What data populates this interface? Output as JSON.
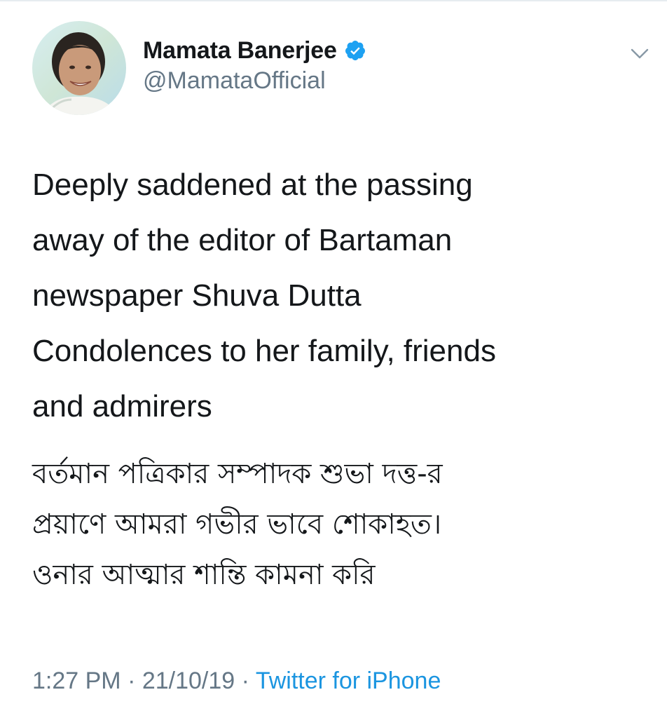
{
  "user": {
    "display_name": "Mamata Banerjee",
    "handle": "@MamataOfficial",
    "verified": true
  },
  "tweet": {
    "english_lines": [
      "Deeply saddened at the passing",
      "away of the editor of Bartaman",
      "newspaper Shuva Dutta",
      "Condolences to her family, friends",
      "and admirers"
    ],
    "bengali_lines": [
      "বর্তমান পত্রিকার সম্পাদক শুভা দত্ত-র",
      "প্রয়াণে আমরা গভীর ভাবে শোকাহত।",
      "ওনার আত্মার শান্তি কামনা করি"
    ]
  },
  "meta": {
    "time": "1:27 PM",
    "separator": " · ",
    "date": "21/10/19",
    "source": "Twitter for iPhone"
  },
  "colors": {
    "text": "#14171a",
    "secondary": "#657786",
    "link": "#1b95e0",
    "verified_badge": "#1da1f2"
  },
  "icons": {
    "verified": "verified-badge-icon",
    "caret": "chevron-down-icon"
  }
}
